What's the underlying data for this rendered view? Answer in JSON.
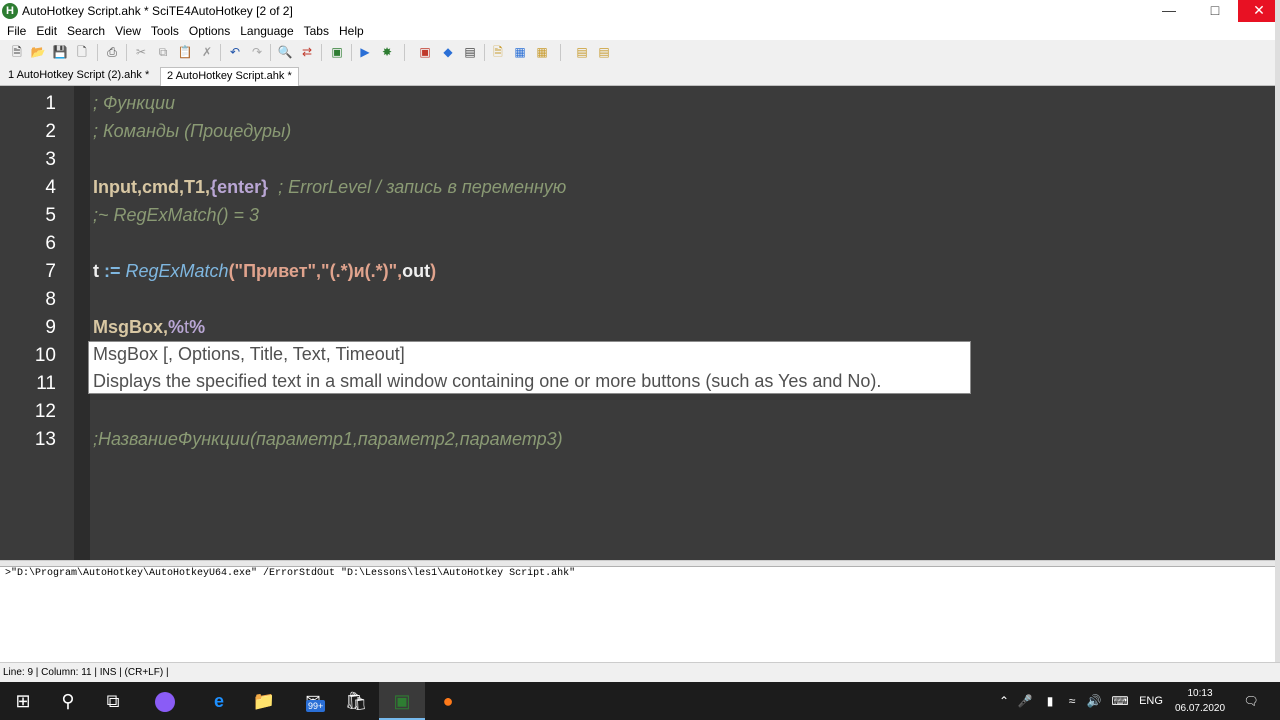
{
  "window": {
    "title": "AutoHotkey Script.ahk * SciTE4AutoHotkey [2 of 2]",
    "app_icon_letter": "H"
  },
  "menu": [
    "File",
    "Edit",
    "Search",
    "View",
    "Tools",
    "Options",
    "Language",
    "Tabs",
    "Help"
  ],
  "tabs": [
    {
      "label": "1 AutoHotkey Script (2).ahk *"
    },
    {
      "label": "2 AutoHotkey Script.ahk *"
    }
  ],
  "editor": {
    "line_numbers": [
      "1",
      "2",
      "3",
      "4",
      "5",
      "6",
      "7",
      "8",
      "9",
      "10",
      "11",
      "12",
      "13"
    ],
    "lines": {
      "l1": "; Функции",
      "l2": "; Команды (Процедуры)",
      "l4_cmd": "Input",
      "l4_rest1": ",",
      "l4_cmd2": "cmd",
      "l4_rest2": ",",
      "l4_cmd3": "T1",
      "l4_rest3": ",",
      "l4_kw": "{enter}",
      "l4_cmt": "  ; ErrorLevel / запись в переменную",
      "l5": ";~ RegExMatch() = 3",
      "l7_var": "t",
      "l7_op": " := ",
      "l7_fn": "RegExMatch",
      "l7_args": "(\"Привет\",\"(.*)и(.*)\",",
      "l7_out": "out",
      "l7_close": ")",
      "l9_cmd": "MsgBox",
      "l9_comma": ",",
      "l9_pct1": "%",
      "l9_var": "t",
      "l9_pct2": "%",
      "l13": ";НазваниеФункции(параметр1,параметр2,параметр3)"
    },
    "calltip": {
      "line1": "MsgBox [, Options, Title, Text, Timeout]",
      "line2": "Displays the specified text in a small window containing one or more buttons  (such as Yes and No)."
    }
  },
  "output": {
    "text": ">\"D:\\Program\\AutoHotkey\\AutoHotkeyU64.exe\" /ErrorStdOut \"D:\\Lessons\\les1\\AutoHotkey Script.ahk\""
  },
  "status": {
    "text": "Line: 9 | Column: 11 | INS | (CR+LF) |"
  },
  "taskbar": {
    "mail_badge": "99+",
    "lang": "ENG",
    "time": "10:13",
    "date": "06.07.2020"
  }
}
